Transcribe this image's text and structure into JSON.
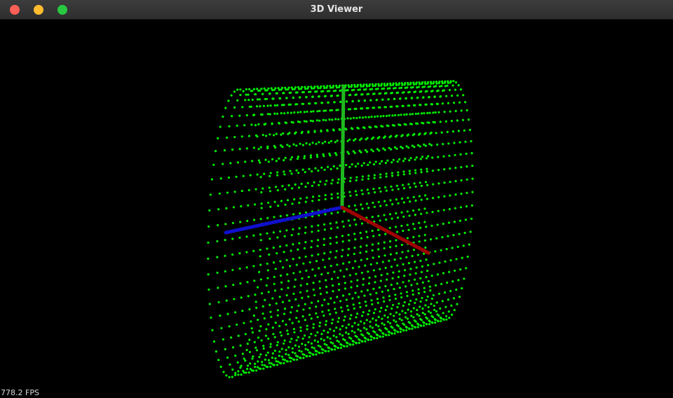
{
  "window": {
    "title": "3D Viewer"
  },
  "scene": {
    "point_color": "#00ee00",
    "background_color": "#000000",
    "axes": {
      "x_color": "#a00000",
      "y_color": "#1fb81f",
      "z_color": "#1010cc"
    }
  },
  "status": {
    "fps": "778.2 FPS"
  }
}
